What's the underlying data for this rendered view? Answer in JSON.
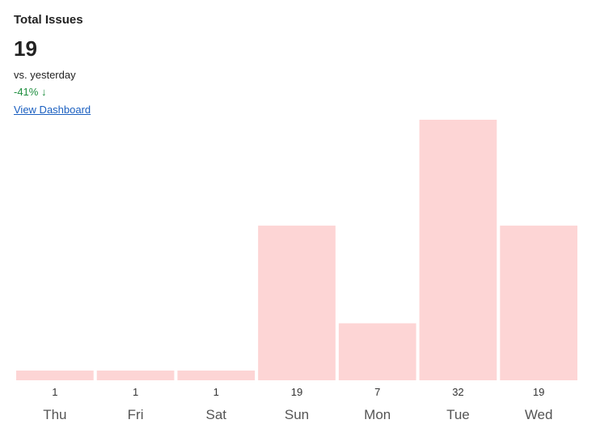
{
  "header": {
    "title": "Total Issues",
    "value": "19",
    "comparison_label": "vs. yesterday",
    "delta": "-41% ↓",
    "delta_color": "#1e8e3e",
    "link_label": "View Dashboard"
  },
  "colors": {
    "bar": "#fdd5d5",
    "link": "#1a5fc0"
  },
  "chart_data": {
    "type": "bar",
    "title": "Total Issues",
    "xlabel": "",
    "ylabel": "",
    "categories": [
      "Thu",
      "Fri",
      "Sat",
      "Sun",
      "Mon",
      "Tue",
      "Wed"
    ],
    "values": [
      1,
      1,
      1,
      19,
      7,
      32,
      19
    ],
    "ylim": [
      0,
      32
    ],
    "grid": false,
    "legend": "none",
    "data_labels": true
  }
}
